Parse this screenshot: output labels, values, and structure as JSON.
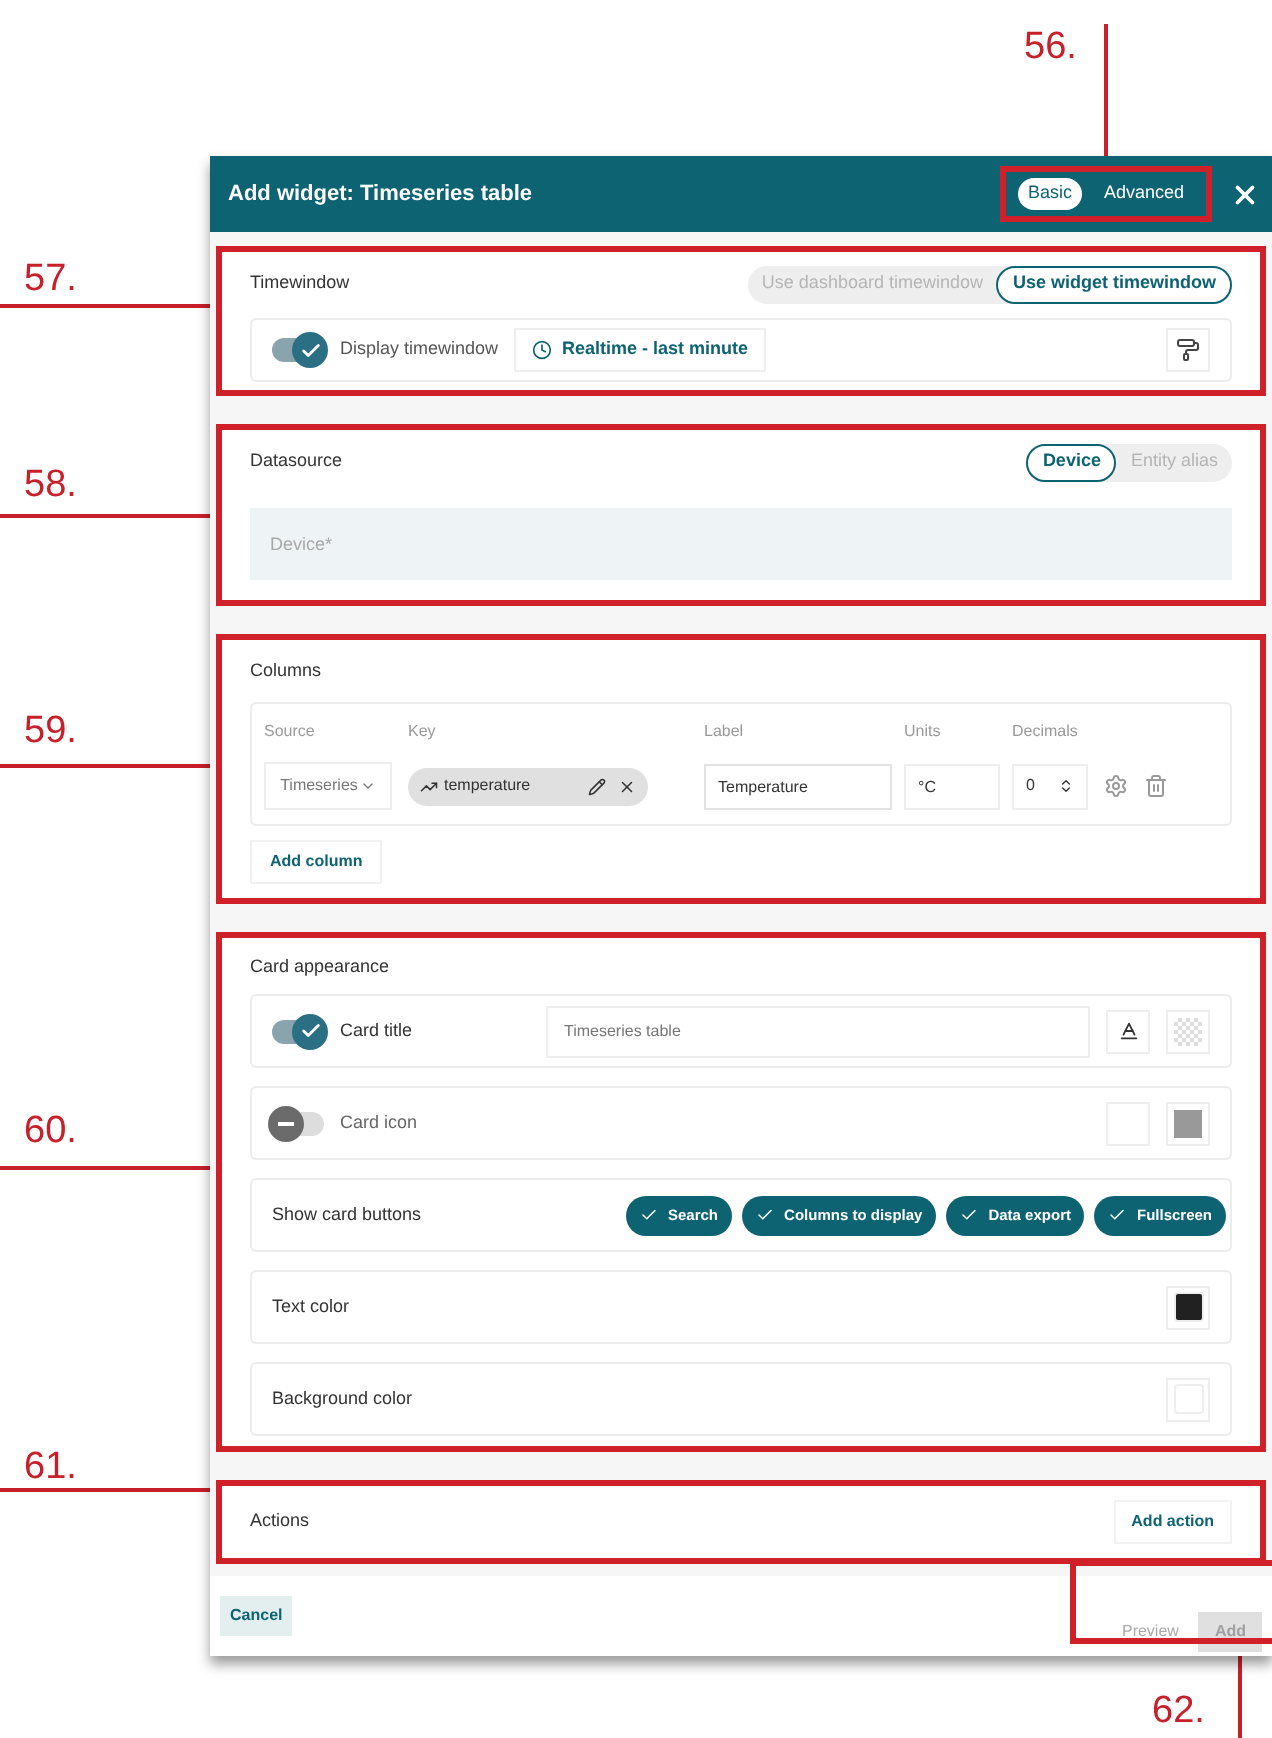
{
  "callouts": [
    "56.",
    "57.",
    "58.",
    "59.",
    "60.",
    "61.",
    "62."
  ],
  "header": {
    "title": "Add widget: Timeseries table",
    "modes": [
      {
        "label": "Basic",
        "selected": true
      },
      {
        "label": "Advanced",
        "selected": false
      }
    ]
  },
  "timewindow": {
    "title": "Timewindow",
    "options": [
      {
        "label": "Use dashboard timewindow",
        "selected": false
      },
      {
        "label": "Use widget timewindow",
        "selected": true
      }
    ],
    "display": {
      "label": "Display timewindow",
      "on": true
    },
    "interval": "Realtime - last minute"
  },
  "datasource": {
    "title": "Datasource",
    "types": [
      {
        "label": "Device",
        "selected": true
      },
      {
        "label": "Entity alias",
        "selected": false
      }
    ],
    "placeholder": "Device*"
  },
  "columns": {
    "title": "Columns",
    "headers": [
      "Source",
      "Key",
      "Label",
      "Units",
      "Decimals"
    ],
    "rows": [
      {
        "source": "Timeseries",
        "key": "temperature",
        "label": "Temperature",
        "units": "°C",
        "decimals": "0"
      }
    ],
    "add": "Add column"
  },
  "card_appearance": {
    "title": "Card appearance",
    "rows": [
      {
        "kind": "toggle_text",
        "label": "Card title",
        "on": true,
        "value": "Timeseries table"
      },
      {
        "kind": "toggle_icon",
        "label": "Card icon",
        "on": false
      },
      {
        "kind": "chips",
        "label": "Show card buttons",
        "chips": [
          {
            "label": "Search",
            "checked": true
          },
          {
            "label": "Columns to display",
            "checked": true
          },
          {
            "label": "Data export",
            "checked": true
          },
          {
            "label": "Fullscreen",
            "checked": true
          }
        ]
      },
      {
        "kind": "color",
        "label": "Text color",
        "color": "#212121"
      },
      {
        "kind": "color",
        "label": "Background color",
        "color": "#ffffff"
      }
    ]
  },
  "actions": {
    "title": "Actions",
    "button": "Add action"
  },
  "footer": {
    "cancel": "Cancel",
    "preview": "Preview",
    "add": {
      "label": "Add",
      "disabled": true
    }
  }
}
